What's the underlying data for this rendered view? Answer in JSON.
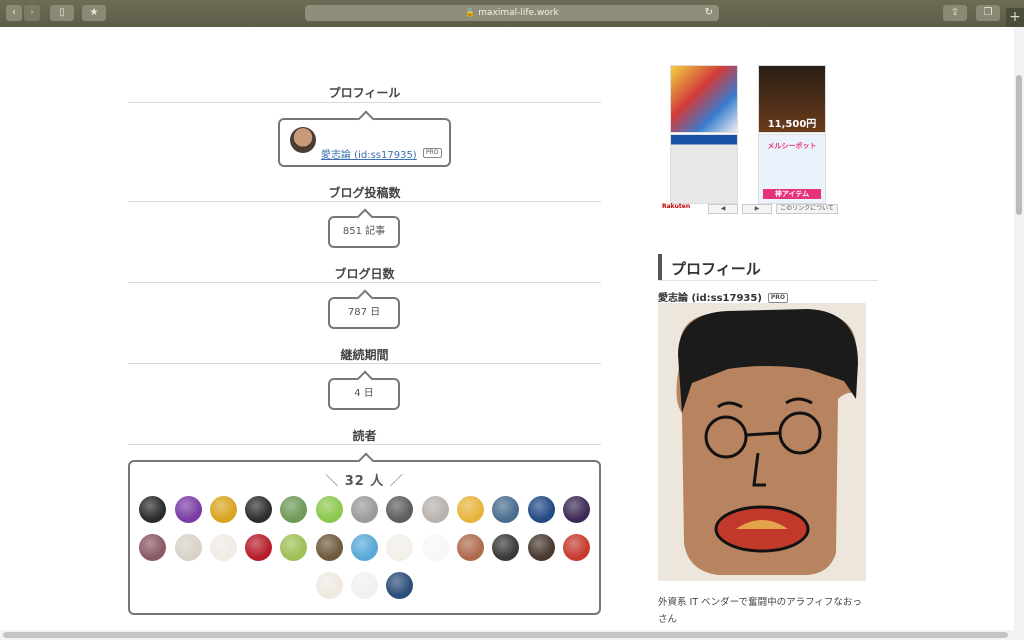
{
  "browser": {
    "url": "maximal-life.work",
    "back_icon": "chevron-left-icon",
    "forward_icon": "chevron-right-icon",
    "sidebar_icon": "sidebar-icon",
    "share_icon": "share-icon",
    "tabs_icon": "tabs-icon",
    "new_tab_label": "+"
  },
  "profile_module": {
    "title": "プロフィール",
    "user_name": "愛志論 (id:ss17935)",
    "badge": "PRO"
  },
  "stats": [
    {
      "title": "ブログ投稿数",
      "value": "851 記事"
    },
    {
      "title": "ブログ日数",
      "value": "787 日"
    },
    {
      "title": "継続期間",
      "value": "4 日"
    }
  ],
  "readers": {
    "title": "読者",
    "count_left": "＼",
    "count": "32 人",
    "count_right": "／",
    "avatar_colors": [
      "#2b2b2b",
      "#7a3da5",
      "#d9a521",
      "#2e2e2e",
      "#6f9a5a",
      "#8dc84f",
      "#9b9b9b",
      "#5e5e5e",
      "#b9b3ae",
      "#e8b53c",
      "#4b6e8f",
      "#234a86",
      "#3d2b56",
      "#8a5a63",
      "#d8d2c7",
      "#f0ebe4",
      "#b61d2b",
      "#9fbf57",
      "#6f5a3f",
      "#5aa9d8",
      "#f3f0ea",
      "#f7f7f7",
      "#b06b4c",
      "#3a3a3a",
      "#4a3a30",
      "#c63b2e",
      "#efe9e2",
      "#f0f0f0",
      "#2c4e7a"
    ]
  },
  "sidebar": {
    "ad": {
      "price": "11,500",
      "price_unit": "円",
      "coupon_text": "メルシーポット",
      "item_label": "神アイテム",
      "brand": "Rakuten",
      "prev_label": "◀",
      "next_label": "▶",
      "about_link": "このリンクについて"
    },
    "profile_title": "プロフィール",
    "user_name": "愛志論 (id:ss17935)",
    "badge": "PRO",
    "description": "外資系 IT ベンダーで奮闘中のアラフィフなおっさん"
  }
}
